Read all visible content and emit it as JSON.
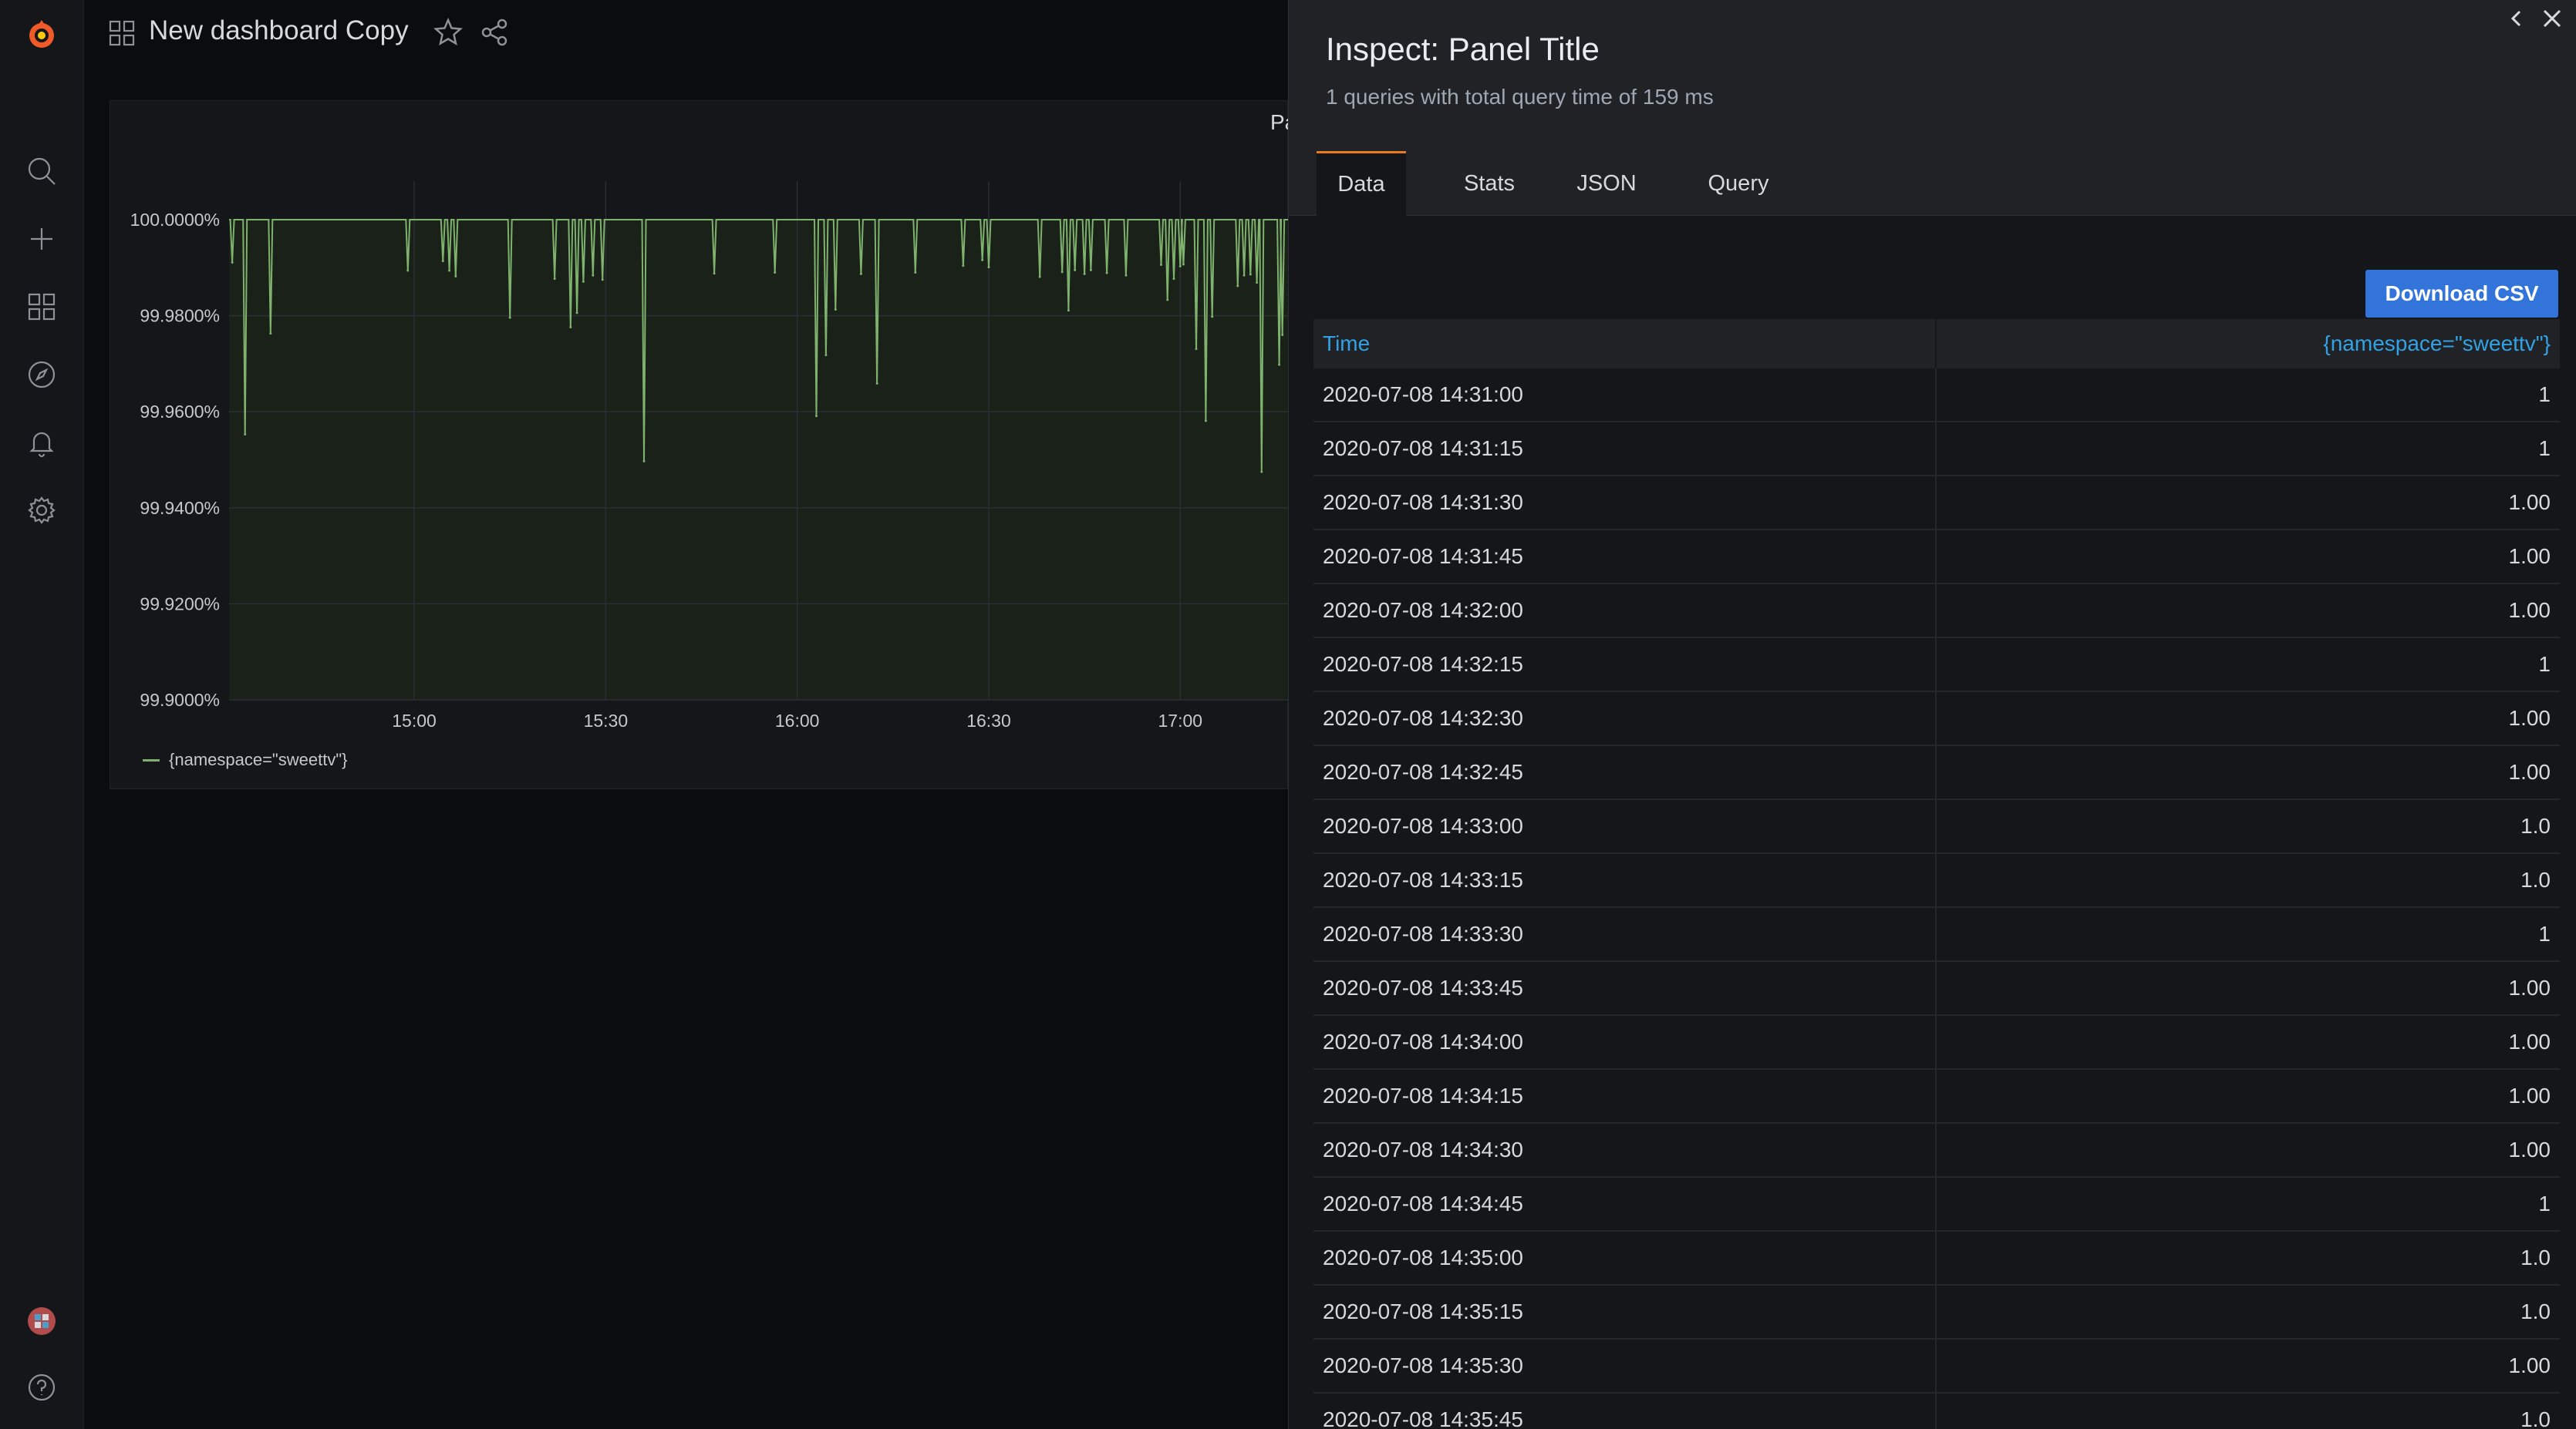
{
  "app": {
    "brand_color": "#eb7b18",
    "accent_color": "#3274d9"
  },
  "sidebar": {
    "items": [
      {
        "icon": "grafana-logo-icon"
      },
      {
        "icon": "search-icon"
      },
      {
        "icon": "plus-icon"
      },
      {
        "icon": "dashboards-icon"
      },
      {
        "icon": "explore-compass-icon"
      },
      {
        "icon": "alerting-bell-icon"
      },
      {
        "icon": "gear-icon"
      },
      {
        "icon": "avatar"
      },
      {
        "icon": "help-icon"
      }
    ]
  },
  "header": {
    "title": "New dashboard Copy"
  },
  "panel": {
    "title_partial": "Pa",
    "legend": "{namespace=\"sweettv\"}"
  },
  "chart_data": {
    "type": "line",
    "title": "",
    "xlabel": "",
    "ylabel": "",
    "y_ticks": [
      "100.0000%",
      "99.9800%",
      "99.9600%",
      "99.9400%",
      "99.9200%",
      "99.9000%"
    ],
    "ylim": [
      99.9,
      100.0
    ],
    "x_ticks": [
      "15:00",
      "15:30",
      "16:00",
      "16:30",
      "17:00"
    ],
    "x_range": [
      "14:31",
      "17:17"
    ],
    "grid": true,
    "series": [
      {
        "name": "{namespace=\"sweettv\"}",
        "color": "#7eb26d",
        "baseline": 100.0,
        "dips": [
          {
            "t": "14:31:30",
            "v": 99.9911
          },
          {
            "t": "14:33:30",
            "v": 99.9553
          },
          {
            "t": "14:37:30",
            "v": 99.9763
          },
          {
            "t": "14:59:00",
            "v": 99.9894
          },
          {
            "t": "15:04:30",
            "v": 99.9914
          },
          {
            "t": "15:05:30",
            "v": 99.9894
          },
          {
            "t": "15:06:30",
            "v": 99.9882
          },
          {
            "t": "15:15:00",
            "v": 99.9796
          },
          {
            "t": "15:22:00",
            "v": 99.9877
          },
          {
            "t": "15:24:30",
            "v": 99.9776
          },
          {
            "t": "15:25:30",
            "v": 99.9806
          },
          {
            "t": "15:26:30",
            "v": 99.9871
          },
          {
            "t": "15:28:00",
            "v": 99.9884
          },
          {
            "t": "15:29:30",
            "v": 99.9875
          },
          {
            "t": "15:36:00",
            "v": 99.9497
          },
          {
            "t": "15:47:00",
            "v": 99.9888
          },
          {
            "t": "15:56:30",
            "v": 99.989
          },
          {
            "t": "16:03:00",
            "v": 99.9591
          },
          {
            "t": "16:04:30",
            "v": 99.9718
          },
          {
            "t": "16:06:00",
            "v": 99.9813
          },
          {
            "t": "16:10:00",
            "v": 99.9887
          },
          {
            "t": "16:12:30",
            "v": 99.9659
          },
          {
            "t": "16:18:30",
            "v": 99.989
          },
          {
            "t": "16:26:00",
            "v": 99.9904
          },
          {
            "t": "16:29:00",
            "v": 99.9916
          },
          {
            "t": "16:30:00",
            "v": 99.9901
          },
          {
            "t": "16:38:00",
            "v": 99.9881
          },
          {
            "t": "16:41:30",
            "v": 99.9891
          },
          {
            "t": "16:42:30",
            "v": 99.9811
          },
          {
            "t": "16:43:30",
            "v": 99.9895
          },
          {
            "t": "16:45:00",
            "v": 99.9887
          },
          {
            "t": "16:46:00",
            "v": 99.9895
          },
          {
            "t": "16:48:30",
            "v": 99.9889
          },
          {
            "t": "16:51:30",
            "v": 99.9884
          },
          {
            "t": "16:57:00",
            "v": 99.9906
          },
          {
            "t": "16:58:00",
            "v": 99.9833
          },
          {
            "t": "16:59:00",
            "v": 99.9877
          },
          {
            "t": "17:00:00",
            "v": 99.9903
          },
          {
            "t": "17:00:30",
            "v": 99.9907
          },
          {
            "t": "17:02:30",
            "v": 99.9731
          },
          {
            "t": "17:04:00",
            "v": 99.9581
          },
          {
            "t": "17:05:00",
            "v": 99.9798
          },
          {
            "t": "17:09:00",
            "v": 99.9862
          },
          {
            "t": "17:10:00",
            "v": 99.9884
          },
          {
            "t": "17:11:00",
            "v": 99.9886
          },
          {
            "t": "17:12:00",
            "v": 99.9869
          },
          {
            "t": "17:12:45",
            "v": 99.9475
          },
          {
            "t": "17:15:30",
            "v": 99.9698
          },
          {
            "t": "17:16:00",
            "v": 99.976
          }
        ]
      }
    ]
  },
  "inspect": {
    "title": "Inspect: Panel Title",
    "subtitle": "1 queries with total query time of 159 ms",
    "tabs": [
      {
        "label": "Data",
        "active": true
      },
      {
        "label": "Stats",
        "active": false
      },
      {
        "label": "JSON",
        "active": false
      },
      {
        "label": "Query",
        "active": false
      }
    ],
    "download_label": "Download CSV",
    "table": {
      "columns": [
        "Time",
        "{namespace=\"sweettv\"}"
      ],
      "rows": [
        [
          "2020-07-08 14:31:00",
          "1"
        ],
        [
          "2020-07-08 14:31:15",
          "1"
        ],
        [
          "2020-07-08 14:31:30",
          "1.00"
        ],
        [
          "2020-07-08 14:31:45",
          "1.00"
        ],
        [
          "2020-07-08 14:32:00",
          "1.00"
        ],
        [
          "2020-07-08 14:32:15",
          "1"
        ],
        [
          "2020-07-08 14:32:30",
          "1.00"
        ],
        [
          "2020-07-08 14:32:45",
          "1.00"
        ],
        [
          "2020-07-08 14:33:00",
          "1.0"
        ],
        [
          "2020-07-08 14:33:15",
          "1.0"
        ],
        [
          "2020-07-08 14:33:30",
          "1"
        ],
        [
          "2020-07-08 14:33:45",
          "1.00"
        ],
        [
          "2020-07-08 14:34:00",
          "1.00"
        ],
        [
          "2020-07-08 14:34:15",
          "1.00"
        ],
        [
          "2020-07-08 14:34:30",
          "1.00"
        ],
        [
          "2020-07-08 14:34:45",
          "1"
        ],
        [
          "2020-07-08 14:35:00",
          "1.0"
        ],
        [
          "2020-07-08 14:35:15",
          "1.0"
        ],
        [
          "2020-07-08 14:35:30",
          "1.00"
        ],
        [
          "2020-07-08 14:35:45",
          "1.0"
        ]
      ]
    }
  }
}
